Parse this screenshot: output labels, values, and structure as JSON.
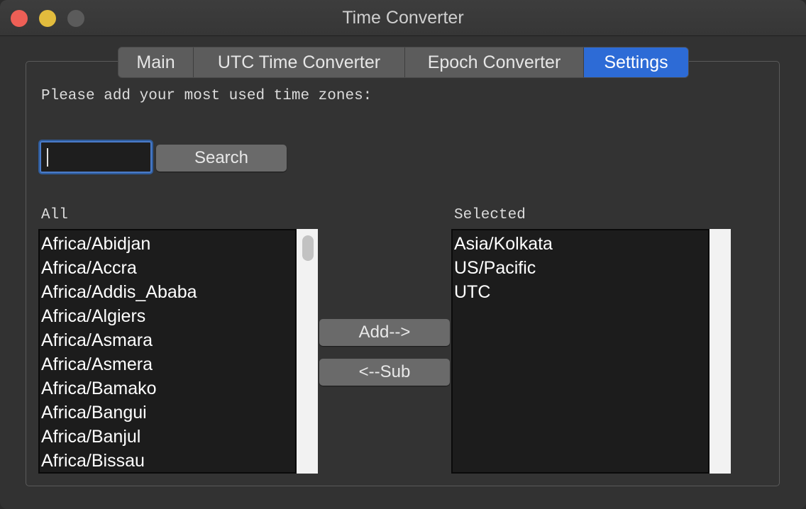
{
  "window": {
    "title": "Time Converter"
  },
  "tabs": [
    {
      "label": "Main"
    },
    {
      "label": "UTC Time Converter"
    },
    {
      "label": "Epoch Converter"
    },
    {
      "label": "Settings",
      "selected": true
    }
  ],
  "settings": {
    "prompt": "Please add your most used time zones:",
    "search_value": "",
    "search_button": "Search",
    "all_label": "All",
    "selected_label": "Selected",
    "add_button": "Add-->",
    "sub_button": "<--Sub",
    "all_zones": [
      "Africa/Abidjan",
      "Africa/Accra",
      "Africa/Addis_Ababa",
      "Africa/Algiers",
      "Africa/Asmara",
      "Africa/Asmera",
      "Africa/Bamako",
      "Africa/Bangui",
      "Africa/Banjul",
      "Africa/Bissau"
    ],
    "selected_zones": [
      "Asia/Kolkata",
      "US/Pacific",
      "UTC"
    ]
  },
  "colors": {
    "accent": "#2d6bd6",
    "close": "#ee5f56",
    "minimize": "#e2bc3d",
    "maximize_disabled": "#5b5b5b"
  },
  "icons": {
    "close": "close-icon",
    "minimize": "minimize-icon",
    "maximize": "maximize-icon"
  }
}
